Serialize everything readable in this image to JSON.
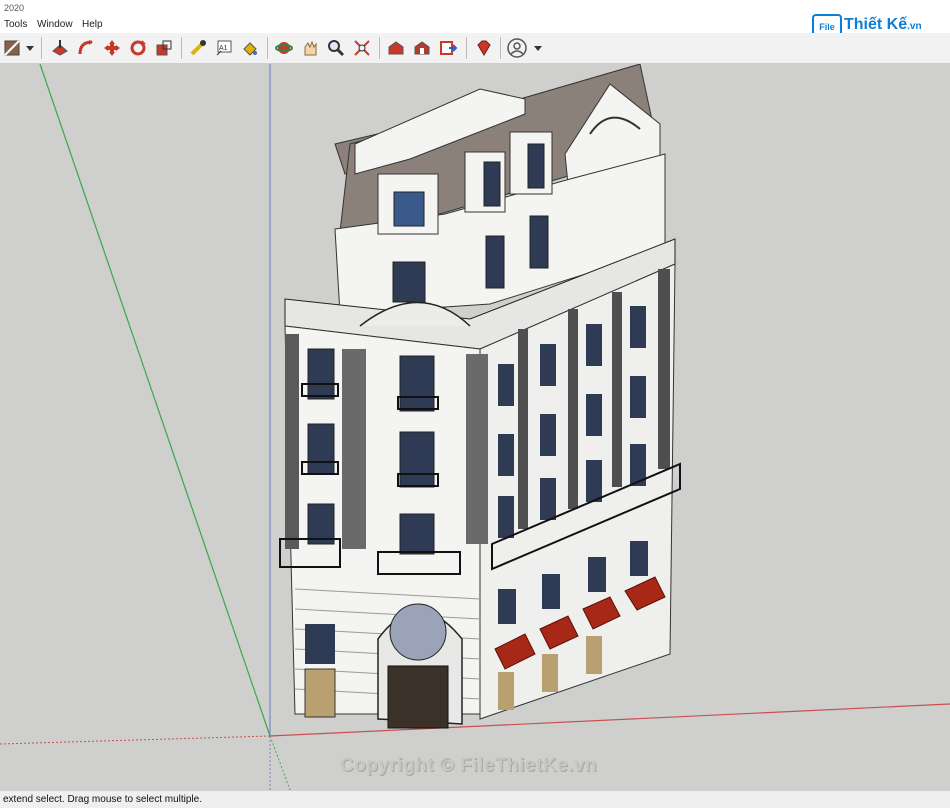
{
  "app": {
    "title": "2020"
  },
  "menu": {
    "tools": "Tools",
    "window": "Window",
    "help": "Help"
  },
  "logo": {
    "mark": "File",
    "text": "Thiết Kế",
    "suffix": ".vn"
  },
  "toolbar": {
    "icons": [
      "paint-bucket-icon",
      "dropdown-icon",
      "push-pull-icon",
      "follow-me-icon",
      "move-icon",
      "rotate-icon",
      "scale-icon",
      "tape-measure-icon",
      "text-label-icon",
      "paint-icon",
      "orbit-icon",
      "pan-icon",
      "zoom-icon",
      "zoom-extents-icon",
      "warehouse-icon",
      "extension-warehouse-icon",
      "send-to-layout-icon",
      "ruby-icon",
      "user-account-icon",
      "dropdown-icon"
    ],
    "text_label_glyph": "A1"
  },
  "watermark": {
    "text": "Copyright © FileThietKe.vn"
  },
  "status": {
    "text": "extend select. Drag mouse to select multiple."
  },
  "colors": {
    "viewport_bg": "#cfcfcd",
    "axis_green": "#3aa84a",
    "axis_blue": "#7b86c9",
    "axis_red": "#c85050",
    "roof": "#8c807b",
    "wall": "#f4f4f2",
    "awning": "#a82818"
  }
}
